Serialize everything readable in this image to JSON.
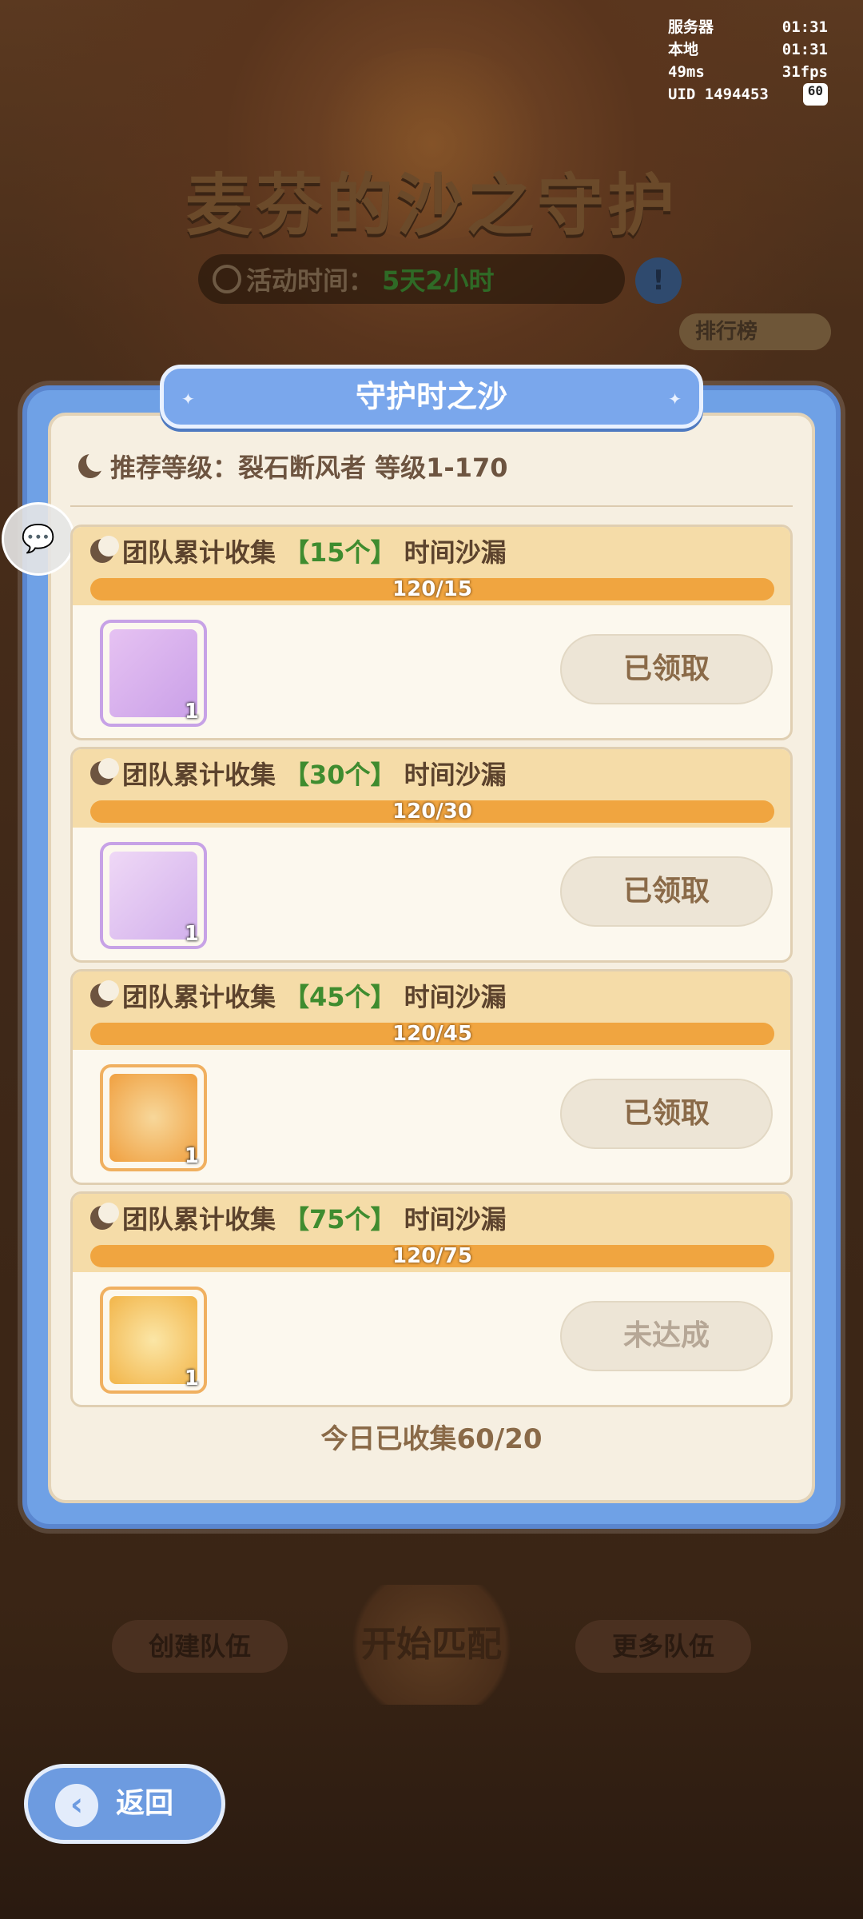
{
  "stats": {
    "server_label": "服务器",
    "server_time": "01:31",
    "local_label": "本地",
    "local_time": "01:31",
    "ping": "49ms",
    "fps": "31fps",
    "uid": "UID 1494453",
    "battery": "60"
  },
  "event": {
    "title": "麦芬的沙之守护",
    "time_label": "活动时间：",
    "time_value": "5天2小时",
    "info_icon": "!",
    "rank_label": "排行榜"
  },
  "modal": {
    "title": "守护时之沙",
    "recommend": "推荐等级：裂石断风者  等级1-170",
    "rewards": [
      {
        "prefix": "团队累计收集",
        "count": "【15个】",
        "suffix": "时间沙漏",
        "progress": "120/15",
        "progress_fraction": 1,
        "qty": "1",
        "button": "已领取",
        "item_icon": "photo-card-icon"
      },
      {
        "prefix": "团队累计收集",
        "count": "【30个】",
        "suffix": "时间沙漏",
        "progress": "120/30",
        "progress_fraction": 1,
        "qty": "1",
        "button": "已领取",
        "item_icon": "fox-sticker-icon"
      },
      {
        "prefix": "团队累计收集",
        "count": "【45个】",
        "suffix": "时间沙漏",
        "progress": "120/45",
        "progress_fraction": 1,
        "qty": "1",
        "button": "已领取",
        "item_icon": "fox-avatar-icon"
      },
      {
        "prefix": "团队累计收集",
        "count": "【75个】",
        "suffix": "时间沙漏",
        "progress": "120/75",
        "progress_fraction": 1,
        "qty": "1",
        "button": "未达成",
        "item_icon": "sand-frame-icon"
      }
    ],
    "today": "今日已收集60/20"
  },
  "bottom": {
    "create_team": "创建队伍",
    "start_match": "开始匹配",
    "more_teams": "更多队伍",
    "back": "返回"
  },
  "colors": {
    "modal_frame": "#6fa1e6",
    "card_header": "#f5dca8",
    "progress": "#f0a540",
    "count_green": "#3f8c2f"
  }
}
